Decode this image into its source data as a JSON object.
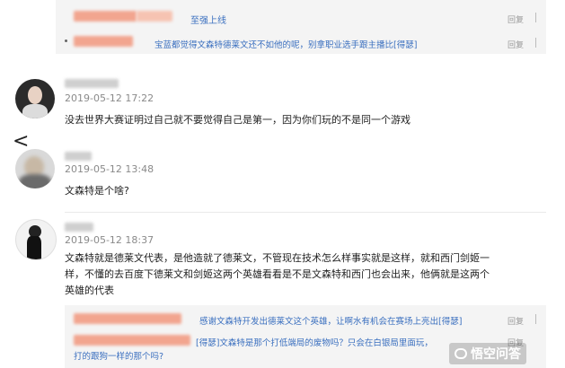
{
  "top_replies": [
    {
      "text": "至强上线",
      "reply": "回复"
    },
    {
      "text": "宝蓝都觉得文森特德莱文还不如他的呢，别拿职业选手跟主播比[得瑟]",
      "reply": "回复"
    }
  ],
  "comments": [
    {
      "date": "2019-05-12 17:22",
      "lines": [
        "没去世界大赛证明过自己就不要觉得自己是第一，因为你们玩的不是同一个游戏"
      ]
    },
    {
      "date": "2019-05-12 13:48",
      "lines": [
        "文森特是个啥?"
      ]
    },
    {
      "date": "2019-05-12 18:37",
      "lines": [
        "文森特就是德莱文代表，是他造就了德莱文，不管现在技术怎么样事实就是这样，就和西门剑姬一",
        "样，不懂的去百度下德莱文和剑姬这两个英雄看看是不是文森特和西门也会出来，他俩就是这两个",
        "英雄的代表"
      ]
    }
  ],
  "sub_replies": [
    {
      "text": "感谢文森特开发出德莱文这个英雄，让啊水有机会在赛场上亮出[得瑟]",
      "reply": "回复"
    },
    {
      "text": "[得瑟]文森特是那个打低端局的废物吗？只会在白银局里面玩，",
      "text2": "打的跟狗一样的那个吗?",
      "reply": "回复"
    }
  ],
  "nav": {
    "back": "<"
  },
  "watermark": {
    "text": "悟空问答"
  }
}
